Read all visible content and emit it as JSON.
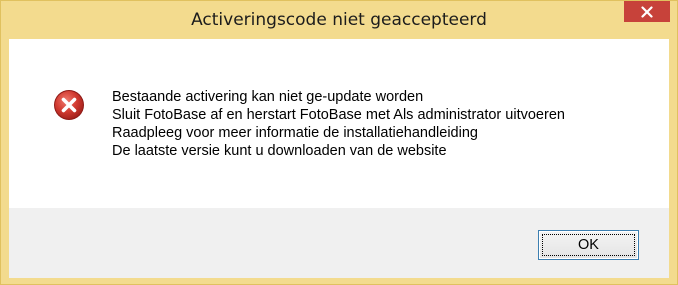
{
  "dialog": {
    "title": "Activeringscode niet geaccepteerd",
    "icon": "error-icon",
    "message_lines": [
      "Bestaande activering kan niet ge-update worden",
      "Sluit FotoBase af en herstart FotoBase met Als administrator uitvoeren",
      "Raadpleeg voor meer informatie de installatiehandleiding",
      "De laatste versie kunt u downloaden van de website"
    ],
    "ok_label": "OK"
  },
  "colors": {
    "titlebar": "#f3db8e",
    "close_button": "#c7423a",
    "error_icon": "#c32b2b",
    "footer": "#f0f0f0",
    "button_border": "#3c7fb1"
  },
  "icons": {
    "close": "close-icon",
    "error": "error-icon"
  }
}
